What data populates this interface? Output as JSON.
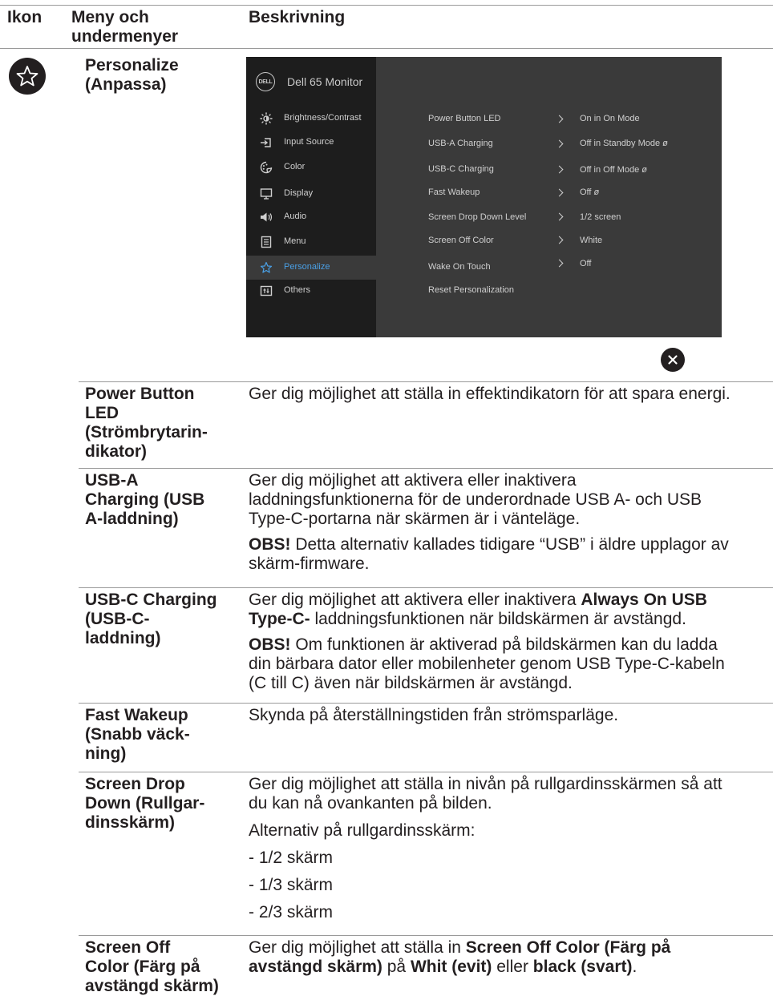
{
  "headers": {
    "icon": "Ikon",
    "menu": "Meny och undermenyer",
    "desc": "Beskrivning"
  },
  "section": {
    "icon": "star-icon",
    "title": "Personalize (Anpassa)"
  },
  "osd": {
    "title": "Dell 65 Monitor",
    "logo": "DELL",
    "menu": [
      {
        "label": "Brightness/Contrast",
        "icon": "brightness-icon"
      },
      {
        "label": "Input Source",
        "icon": "input-source-icon"
      },
      {
        "label": "Color",
        "icon": "color-icon"
      },
      {
        "label": "Display",
        "icon": "display-icon"
      },
      {
        "label": "Audio",
        "icon": "audio-icon"
      },
      {
        "label": "Menu",
        "icon": "menu-icon"
      },
      {
        "label": "Personalize",
        "icon": "star-icon",
        "active": true
      },
      {
        "label": "Others",
        "icon": "others-icon"
      }
    ],
    "options": [
      {
        "label": "Power Button LED",
        "value": "On in On Mode"
      },
      {
        "label": "USB-A Charging",
        "value": "Off in Standby Mode",
        "locked": true
      },
      {
        "label": "USB-C Charging",
        "value": "Off in Off Mode",
        "locked": true
      },
      {
        "label": "Fast Wakeup",
        "value": "Off",
        "locked": true
      },
      {
        "label": "Screen Drop Down Level",
        "value": "1/2 screen"
      },
      {
        "label": "Screen Off Color",
        "value": "White"
      },
      {
        "label": "Wake On Touch",
        "value": "Off"
      },
      {
        "label": "Reset Personalization",
        "value": ""
      }
    ],
    "lock_glyph": "ø",
    "close_icon": "close-icon",
    "active_color": "#4aa0e6"
  },
  "rows": [
    {
      "label": "Power Button LED (Strömbrytarin-dikator)",
      "label_lines": [
        "Power Button",
        "LED",
        "(Strömbrytarin-",
        "dikator)"
      ],
      "desc_lines": [
        "Ger dig möjlighet att ställa in effektindikatorn för att spara energi."
      ]
    },
    {
      "label": "USB-A Charging (USB A-laddning)",
      "label_lines": [
        "USB-A",
        "Charging (USB",
        "A-laddning)"
      ],
      "desc_lines": [
        "Ger dig möjlighet att aktivera eller inaktivera",
        "laddningsfunktionerna för de underordnade USB A- och USB",
        "Type-C-portarna när skärmen är i vänteläge."
      ],
      "note_bold": "OBS!",
      "note_lines": [
        " Detta alternativ kallades tidigare “USB” i äldre upplagor av",
        "skärm-firmware."
      ]
    },
    {
      "label": "USB-C Charging (USB-C-laddning)",
      "label_lines": [
        "USB-C Charging",
        "(USB-C-",
        "laddning)"
      ],
      "desc_pre": "Ger dig möjlighet att aktivera eller inaktivera ",
      "desc_bold": "Always On USB Type-C-",
      "desc_bold_1": "Always On USB",
      "desc_bold_2": "Type-C-",
      "desc_post": " laddningsfunktionen när bildskärmen är avstängd.",
      "note_bold": "OBS!",
      "note_lines": [
        " Om funktionen är aktiverad på bildskärmen kan du ladda",
        "din bärbara dator eller mobilenheter genom USB Type-C-kabeln",
        "(C till C) även när bildskärmen är avstängd."
      ]
    },
    {
      "label": "Fast Wakeup (Snabb väck-ning)",
      "label_lines": [
        "Fast Wakeup",
        "(Snabb väck-",
        "ning)"
      ],
      "desc_lines": [
        "Skynda på återställningstiden från strömsparläge."
      ]
    },
    {
      "label": "Screen Drop Down (Rullgar-dinsskärm)",
      "label_lines": [
        "Screen Drop",
        "Down (Rullgar-",
        "dinsskärm)"
      ],
      "desc_lines": [
        "Ger dig möjlighet att ställa in nivån på rullgardinsskärmen så att",
        "du kan nå ovankanten på bilden."
      ],
      "options_label": "Alternativ på rullgardinsskärm:",
      "options": [
        "- 1/2 skärm",
        "- 1/3 skärm",
        "- 2/3 skärm"
      ]
    },
    {
      "label": "Screen Off Color (Färg på avstängd skärm)",
      "label_lines": [
        "Screen Off",
        "Color (Färg på",
        "avstängd skärm)"
      ],
      "desc_pre": "Ger dig möjlighet att ställa in ",
      "desc_bold_a": "Screen Off Color (Färg på",
      "desc_bold_b": "avstängd skärm)",
      "desc_mid": " på ",
      "desc_bold_c": "Whit (evit)",
      "desc_mid2": " eller ",
      "desc_bold_d": "black (svart)",
      "desc_end": "."
    }
  ]
}
